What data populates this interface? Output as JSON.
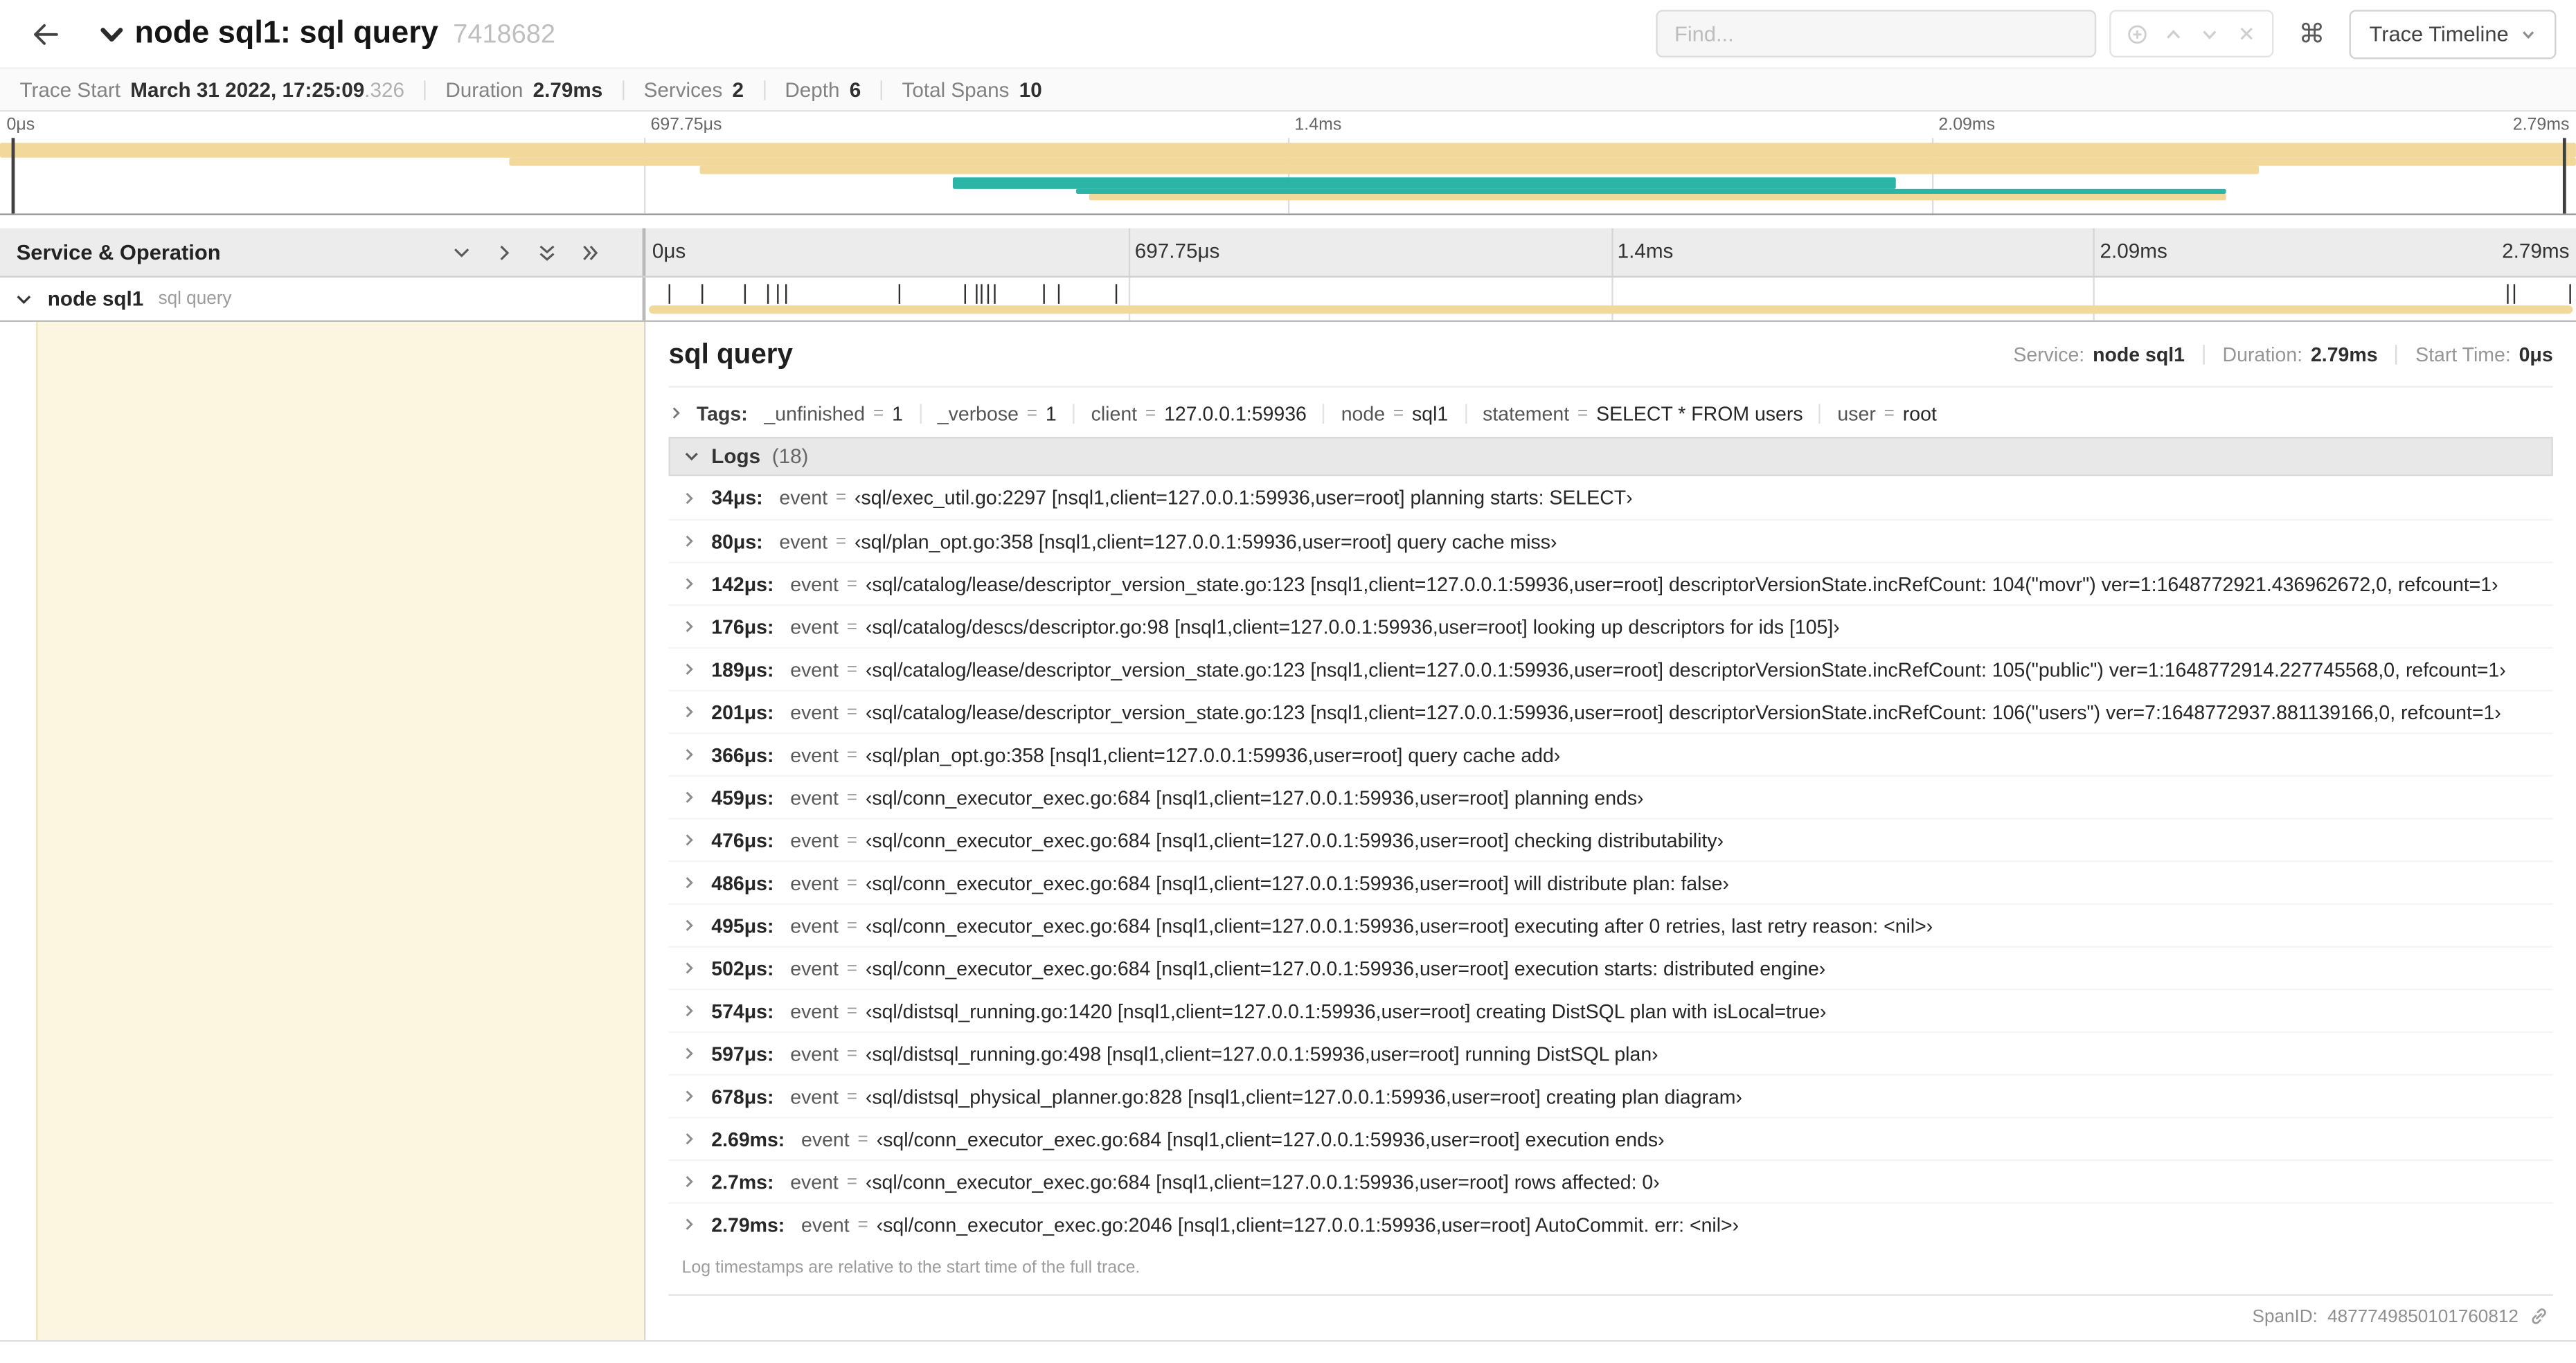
{
  "colors": {
    "tan": "#F2D89A",
    "teal": "#2BB5A6",
    "cream": "#FCF5E0"
  },
  "header": {
    "title": "node sql1: sql query",
    "trace_id": "7418682",
    "find_placeholder": "Find...",
    "view_button_label": "Trace Timeline"
  },
  "summary": {
    "items": [
      {
        "label": "Trace Start",
        "value": "March 31 2022, 17:25:09",
        "suffix": ".326"
      },
      {
        "label": "Duration",
        "value": "2.79ms"
      },
      {
        "label": "Services",
        "value": "2"
      },
      {
        "label": "Depth",
        "value": "6"
      },
      {
        "label": "Total Spans",
        "value": "10"
      }
    ]
  },
  "axis_ticks": [
    {
      "label": "0μs",
      "pct": 0
    },
    {
      "label": "697.75μs",
      "pct": 25
    },
    {
      "label": "1.4ms",
      "pct": 50
    },
    {
      "label": "2.09ms",
      "pct": 75
    },
    {
      "label": "2.79ms",
      "pct": 100,
      "align": "right"
    }
  ],
  "minimap_spans": [
    {
      "l": 0,
      "w": 100,
      "t": 3,
      "h": 9,
      "color": "tan"
    },
    {
      "l": 19.8,
      "w": 80.2,
      "t": 12,
      "h": 5,
      "color": "tan"
    },
    {
      "l": 27.2,
      "w": 60.5,
      "t": 17,
      "h": 5,
      "color": "tan"
    },
    {
      "l": 37.0,
      "w": 36.6,
      "t": 24,
      "h": 7,
      "color": "teal"
    },
    {
      "l": 41.8,
      "w": 44.6,
      "t": 31,
      "h": 3,
      "color": "teal"
    },
    {
      "l": 42.3,
      "w": 44.1,
      "t": 34,
      "h": 4,
      "color": "tan"
    }
  ],
  "timeline": {
    "left_header": "Service & Operation",
    "row": {
      "service": "node sql1",
      "operation": "sql query"
    },
    "log_markers": [
      1.2,
      2.9,
      5.1,
      6.3,
      6.8,
      7.2,
      13.1,
      16.5,
      17.1,
      17.4,
      17.7,
      18.0,
      20.6,
      21.4,
      24.3,
      96.4,
      96.8,
      99.7
    ]
  },
  "detail": {
    "title": "sql query",
    "meta": [
      {
        "label": "Service:",
        "value": "node sql1"
      },
      {
        "label": "Duration:",
        "value": "2.79ms"
      },
      {
        "label": "Start Time:",
        "value": "0μs"
      }
    ],
    "tags_label": "Tags:",
    "tags": [
      {
        "key": "_unfinished",
        "value": "1"
      },
      {
        "key": "_verbose",
        "value": "1"
      },
      {
        "key": "client",
        "value": "127.0.0.1:59936"
      },
      {
        "key": "node",
        "value": "sql1"
      },
      {
        "key": "statement",
        "value": "SELECT * FROM users"
      },
      {
        "key": "user",
        "value": "root"
      }
    ],
    "logs_title": "Logs",
    "logs_count": "(18)",
    "logs": [
      {
        "time": "34μs:",
        "key": "event",
        "value": "‹sql/exec_util.go:2297 [nsql1,client=127.0.0.1:59936,user=root] planning starts: SELECT›"
      },
      {
        "time": "80μs:",
        "key": "event",
        "value": "‹sql/plan_opt.go:358 [nsql1,client=127.0.0.1:59936,user=root] query cache miss›"
      },
      {
        "time": "142μs:",
        "key": "event",
        "value": "‹sql/catalog/lease/descriptor_version_state.go:123 [nsql1,client=127.0.0.1:59936,user=root] descriptorVersionState.incRefCount: 104(\"movr\") ver=1:1648772921.436962672,0, refcount=1›"
      },
      {
        "time": "176μs:",
        "key": "event",
        "value": "‹sql/catalog/descs/descriptor.go:98 [nsql1,client=127.0.0.1:59936,user=root] looking up descriptors for ids [105]›"
      },
      {
        "time": "189μs:",
        "key": "event",
        "value": "‹sql/catalog/lease/descriptor_version_state.go:123 [nsql1,client=127.0.0.1:59936,user=root] descriptorVersionState.incRefCount: 105(\"public\") ver=1:1648772914.227745568,0, refcount=1›"
      },
      {
        "time": "201μs:",
        "key": "event",
        "value": "‹sql/catalog/lease/descriptor_version_state.go:123 [nsql1,client=127.0.0.1:59936,user=root] descriptorVersionState.incRefCount: 106(\"users\") ver=7:1648772937.881139166,0, refcount=1›"
      },
      {
        "time": "366μs:",
        "key": "event",
        "value": "‹sql/plan_opt.go:358 [nsql1,client=127.0.0.1:59936,user=root] query cache add›"
      },
      {
        "time": "459μs:",
        "key": "event",
        "value": "‹sql/conn_executor_exec.go:684 [nsql1,client=127.0.0.1:59936,user=root] planning ends›"
      },
      {
        "time": "476μs:",
        "key": "event",
        "value": "‹sql/conn_executor_exec.go:684 [nsql1,client=127.0.0.1:59936,user=root] checking distributability›"
      },
      {
        "time": "486μs:",
        "key": "event",
        "value": "‹sql/conn_executor_exec.go:684 [nsql1,client=127.0.0.1:59936,user=root] will distribute plan: false›"
      },
      {
        "time": "495μs:",
        "key": "event",
        "value": "‹sql/conn_executor_exec.go:684 [nsql1,client=127.0.0.1:59936,user=root] executing after 0 retries, last retry reason: <nil>›"
      },
      {
        "time": "502μs:",
        "key": "event",
        "value": "‹sql/conn_executor_exec.go:684 [nsql1,client=127.0.0.1:59936,user=root] execution starts: distributed engine›"
      },
      {
        "time": "574μs:",
        "key": "event",
        "value": "‹sql/distsql_running.go:1420 [nsql1,client=127.0.0.1:59936,user=root] creating DistSQL plan with isLocal=true›"
      },
      {
        "time": "597μs:",
        "key": "event",
        "value": "‹sql/distsql_running.go:498 [nsql1,client=127.0.0.1:59936,user=root] running DistSQL plan›"
      },
      {
        "time": "678μs:",
        "key": "event",
        "value": "‹sql/distsql_physical_planner.go:828 [nsql1,client=127.0.0.1:59936,user=root] creating plan diagram›"
      },
      {
        "time": "2.69ms:",
        "key": "event",
        "value": "‹sql/conn_executor_exec.go:684 [nsql1,client=127.0.0.1:59936,user=root] execution ends›"
      },
      {
        "time": "2.7ms:",
        "key": "event",
        "value": "‹sql/conn_executor_exec.go:684 [nsql1,client=127.0.0.1:59936,user=root] rows affected: 0›"
      },
      {
        "time": "2.79ms:",
        "key": "event",
        "value": "‹sql/conn_executor_exec.go:2046 [nsql1,client=127.0.0.1:59936,user=root] AutoCommit. err: <nil>›"
      }
    ],
    "footnote": "Log timestamps are relative to the start time of the full trace.",
    "spanid_label": "SpanID:",
    "spanid_value": "4877749850101760812"
  },
  "misc": {
    "eq": "="
  }
}
